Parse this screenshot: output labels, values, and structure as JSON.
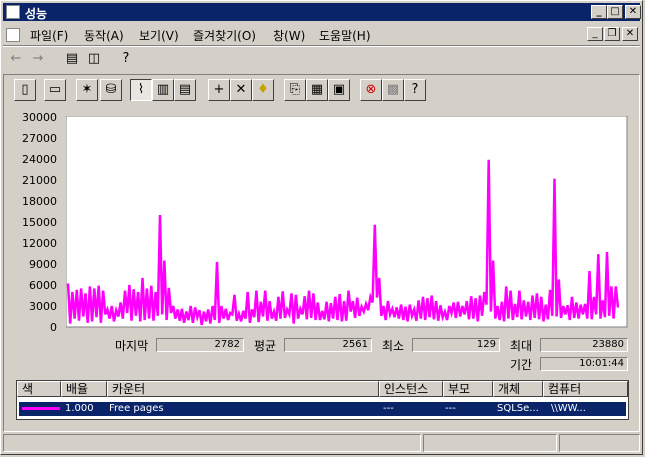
{
  "window": {
    "title": "성능"
  },
  "menu": {
    "items": [
      "파일(F)",
      "동작(A)",
      "보기(V)",
      "즐겨찾기(O)",
      "창(W)",
      "도움말(H)"
    ]
  },
  "stats": {
    "last_label": "마지막",
    "last_value": "2782",
    "avg_label": "평균",
    "avg_value": "2561",
    "min_label": "최소",
    "min_value": "129",
    "max_label": "최대",
    "max_value": "23880",
    "duration_label": "기간",
    "duration_value": "10:01:44"
  },
  "counter_list": {
    "headers": [
      "색",
      "배율",
      "카운터",
      "인스턴스",
      "부모",
      "개체",
      "컴퓨터"
    ],
    "row": {
      "scale": "1.000",
      "counter": "Free pages",
      "instance": "---",
      "parent": "---",
      "object": "SQLSe...",
      "computer": "\\\\WW..."
    }
  },
  "chart_data": {
    "type": "line",
    "ylim": [
      0,
      30000
    ],
    "yticks": [
      "30000",
      "27000",
      "24000",
      "21000",
      "18000",
      "15000",
      "12000",
      "9000",
      "6000",
      "3000",
      "0"
    ],
    "series": [
      {
        "color": "#ff00ff",
        "values": [
          6200,
          500,
          5000,
          1200,
          5300,
          900,
          5500,
          1500,
          4800,
          600,
          5800,
          800,
          5500,
          1400,
          5900,
          600,
          5200,
          1800,
          2500,
          1200,
          3000,
          800,
          2400,
          1500,
          3500,
          1200,
          5200,
          2000,
          6000,
          900,
          5400,
          1600,
          5000,
          800,
          7000,
          1000,
          5500,
          1200,
          5900,
          900,
          5000,
          1600,
          16000,
          1800,
          9500,
          1000,
          5600,
          2000,
          3000,
          1200,
          2500,
          900,
          2600,
          600,
          2200,
          1000,
          3000,
          600,
          2800,
          1400,
          2400,
          300,
          2200,
          800,
          2500,
          500,
          3000,
          1000,
          9300,
          600,
          3000,
          1200,
          2600,
          1000,
          2000,
          1800,
          4600,
          900,
          1900,
          800,
          2300,
          1200,
          5000,
          600,
          2500,
          1400,
          5200,
          700,
          3600,
          1500,
          5200,
          900,
          3700,
          1200,
          2200,
          900,
          4300,
          1200,
          5100,
          1300,
          2500,
          1800,
          4800,
          500,
          4600,
          1200,
          2600,
          1800,
          4400,
          1100,
          5200,
          1300,
          4800,
          1000,
          3500,
          1000,
          2300,
          1100,
          3600,
          800,
          3400,
          1200,
          4300,
          1000,
          4700,
          800,
          3700,
          900,
          5200,
          2200,
          3700,
          1300,
          4200,
          1600,
          2900,
          2200,
          3300,
          2400,
          4300,
          3500,
          14600,
          4200,
          7000,
          1600,
          3000,
          1000,
          3700,
          1800,
          2600,
          1400,
          2800,
          1200,
          3200,
          1000,
          2900,
          800,
          3200,
          1600,
          2500,
          900,
          3800,
          1200,
          4300,
          1000,
          4100,
          1400,
          4500,
          1100,
          3700,
          900,
          3100,
          1400,
          2200,
          1000,
          3000,
          2000,
          3500,
          1300,
          3600,
          1500,
          3000,
          1800,
          3700,
          1100,
          4400,
          1200,
          4100,
          800,
          4500,
          1600,
          5000,
          3200,
          23880,
          2200,
          9500,
          1200,
          3000,
          1000,
          3600,
          800,
          5800,
          1200,
          5200,
          1000,
          3300,
          1400,
          5200,
          1100,
          3800,
          1500,
          3600,
          1000,
          4500,
          1300,
          4800,
          1100,
          4300,
          800,
          3200,
          1100,
          5300,
          1600,
          21200,
          1500,
          6800,
          1300,
          3000,
          1800,
          3100,
          1000,
          4300,
          1300,
          3500,
          1200,
          3200,
          1800,
          3300,
          1200,
          8000,
          1100,
          4300,
          1800,
          10400,
          1200,
          3800,
          1400,
          10700,
          1600,
          5800,
          1200,
          5800,
          2782
        ]
      }
    ]
  }
}
